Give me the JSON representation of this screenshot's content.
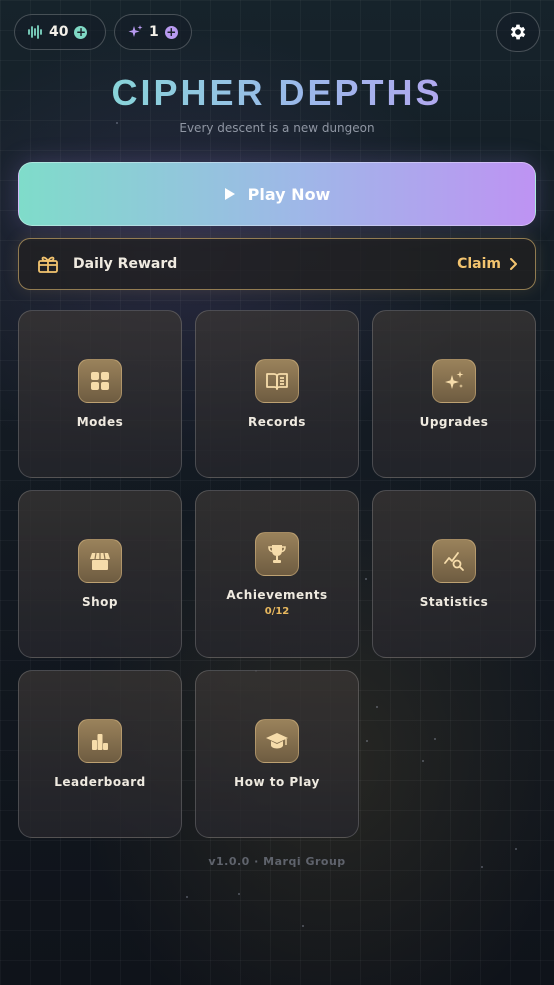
{
  "header": {
    "energy": {
      "value": "40",
      "icon": "soundwave-icon",
      "accent": "#7fd8c4"
    },
    "sparks": {
      "value": "1",
      "icon": "sparkle-icon",
      "accent": "#b89af0"
    },
    "settings_icon": "gear-icon"
  },
  "title": "CIPHER DEPTHS",
  "subtitle": "Every descent is a new dungeon",
  "play": {
    "label": "Play Now",
    "icon": "play-icon"
  },
  "daily": {
    "label": "Daily Reward",
    "action": "Claim",
    "icon": "gift-icon"
  },
  "tiles": [
    {
      "label": "Modes",
      "icon": "grid-icon"
    },
    {
      "label": "Records",
      "icon": "book-icon"
    },
    {
      "label": "Upgrades",
      "icon": "sparkles-icon"
    },
    {
      "label": "Shop",
      "icon": "store-icon"
    },
    {
      "label": "Achievements",
      "sub": "0/12",
      "icon": "trophy-icon"
    },
    {
      "label": "Statistics",
      "icon": "chart-search-icon"
    },
    {
      "label": "Leaderboard",
      "icon": "podium-icon"
    },
    {
      "label": "How to Play",
      "icon": "graduation-cap-icon"
    }
  ],
  "footer": {
    "version": "v1.0.0  ·  Marqi Group"
  },
  "colors": {
    "gold": "#f3c46f",
    "teal": "#7fdcca",
    "violet": "#be93f3"
  }
}
